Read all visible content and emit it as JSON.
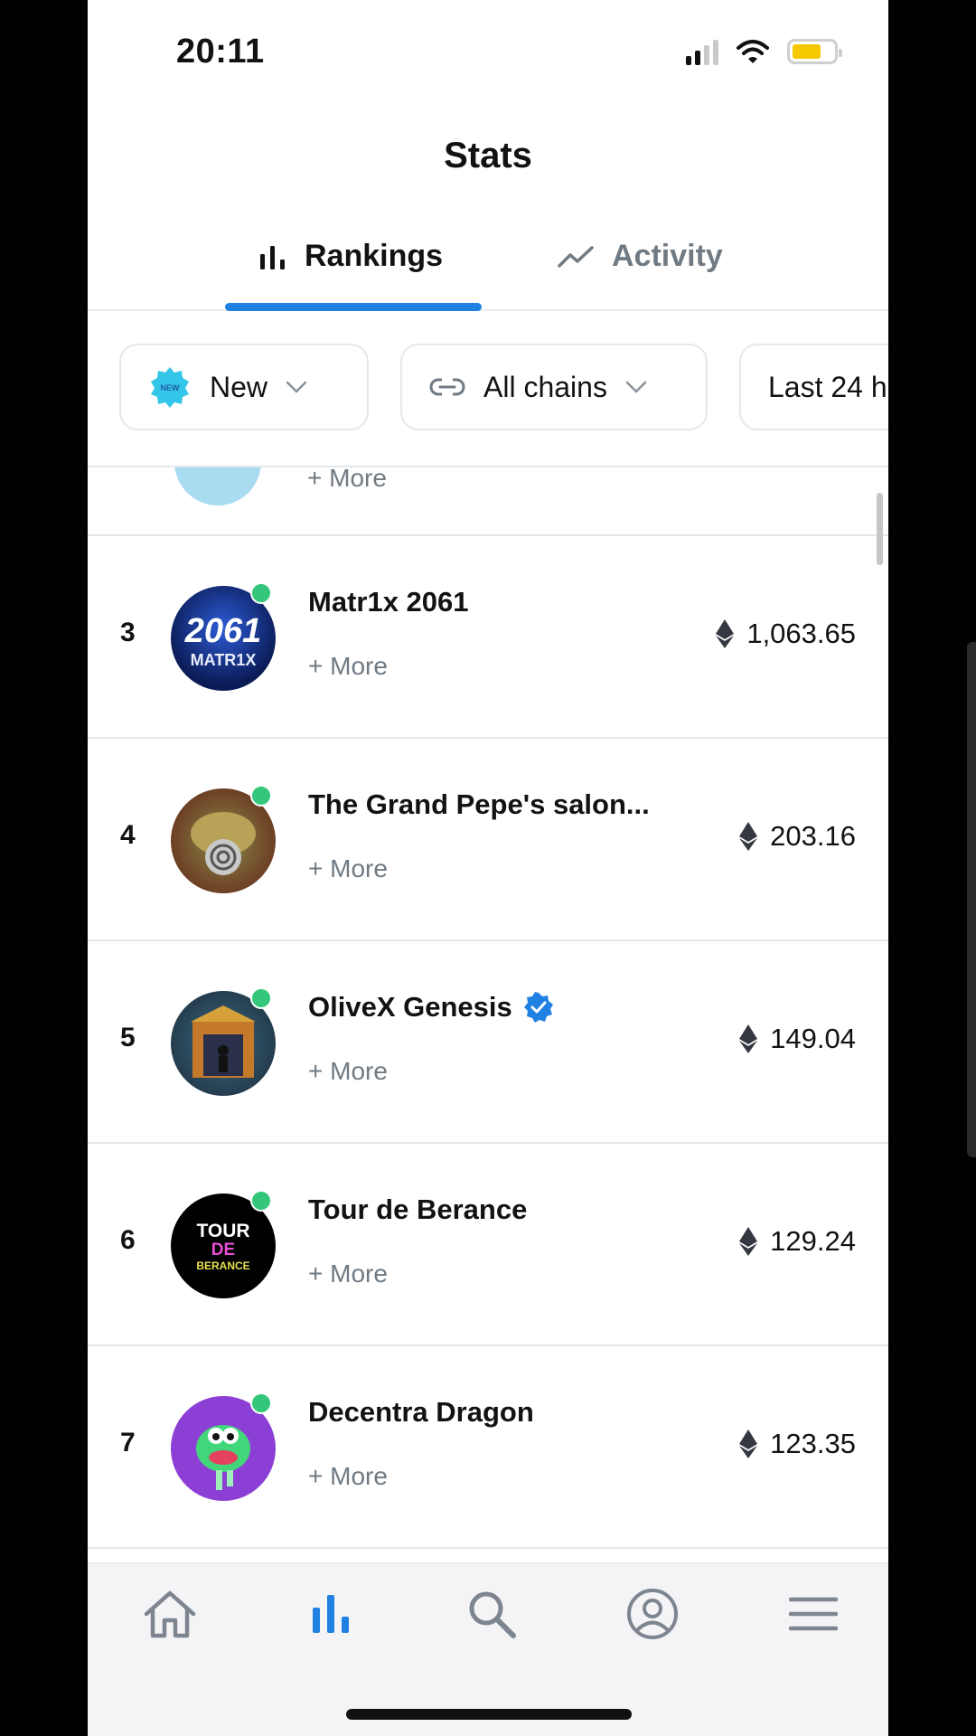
{
  "status_bar": {
    "time": "20:11",
    "battery_color": "#f5c800"
  },
  "header": {
    "title": "Stats"
  },
  "tabs": [
    {
      "label": "Rankings",
      "icon": "bar-chart-icon",
      "active": true
    },
    {
      "label": "Activity",
      "icon": "trend-line-icon",
      "active": false
    }
  ],
  "filters": {
    "category": {
      "label": "New",
      "badge_text": "NEW"
    },
    "chain": {
      "label": "All chains"
    },
    "time": {
      "label": "Last 24 h"
    }
  },
  "list": {
    "partial_row": {
      "more_label": "+ More"
    },
    "rows": [
      {
        "rank": "3",
        "name": "Matr1x 2061",
        "avatar_text_top": "2061",
        "avatar_text_bottom": "MATR1X",
        "verified": false,
        "more_label": "+ More",
        "volume": "1,063.65",
        "currency_icon": "ethereum-icon"
      },
      {
        "rank": "4",
        "name": "The Grand Pepe's salon...",
        "verified": false,
        "more_label": "+ More",
        "volume": "203.16",
        "currency_icon": "ethereum-icon"
      },
      {
        "rank": "5",
        "name": "OliveX Genesis",
        "verified": true,
        "more_label": "+ More",
        "volume": "149.04",
        "currency_icon": "ethereum-icon"
      },
      {
        "rank": "6",
        "name": "Tour de Berance",
        "avatar_text_top": "TOUR",
        "avatar_text_mid": "DE",
        "avatar_text_bottom": "BERANCE",
        "verified": false,
        "more_label": "+ More",
        "volume": "129.24",
        "currency_icon": "ethereum-icon"
      },
      {
        "rank": "7",
        "name": "Decentra Dragon",
        "verified": false,
        "more_label": "+ More",
        "volume": "123.35",
        "currency_icon": "ethereum-icon"
      }
    ]
  },
  "bottom_nav": [
    {
      "icon": "home-icon"
    },
    {
      "icon": "stats-icon",
      "active": true
    },
    {
      "icon": "search-icon"
    },
    {
      "icon": "profile-icon"
    },
    {
      "icon": "menu-icon"
    }
  ],
  "colors": {
    "accent": "#2081e2",
    "muted": "#707a83",
    "online": "#34c77b",
    "verified": "#2081e2"
  }
}
